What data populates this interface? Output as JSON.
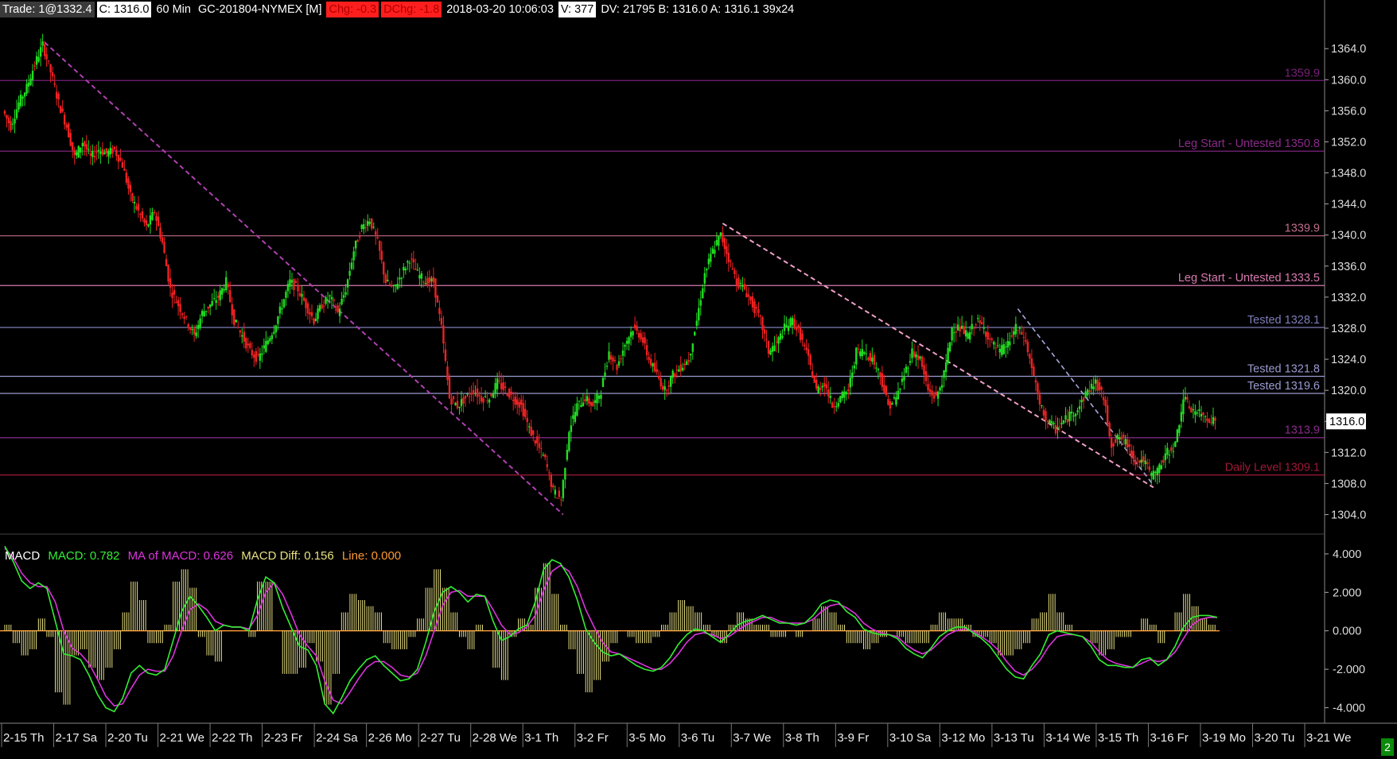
{
  "header": {
    "trade": "Trade: 1@1332.4",
    "close": "C: 1316.0",
    "interval": "60 Min",
    "symbol": "GC-201804-NYMEX [M]",
    "chg": "Chg: -0.3",
    "dchg": "DChg: -1.8",
    "datetime": "2018-03-20 10:06:03",
    "volume": "V: 377",
    "rest": "DV: 21795 B: 1316.0 A: 1316.1 39x24"
  },
  "macd_header": {
    "title": "MACD",
    "macd": "MACD: 0.782",
    "ma": "MA of MACD: 0.626",
    "diff": "MACD Diff: 0.156",
    "line": "Line: 0.000"
  },
  "scroll_indicator": "2",
  "colors": {
    "background": "#000000",
    "bull": "#22dd22",
    "bear": "#ee2222",
    "macd_line": "#33ee33",
    "ma_line": "#dd33dd",
    "diff_bars": "#e8e080",
    "zero_line": "#ff9933"
  },
  "chart_data": [
    {
      "type": "candlestick",
      "title": "",
      "y_ticks": [
        1364.0,
        1360.0,
        1356.0,
        1352.0,
        1348.0,
        1344.0,
        1340.0,
        1336.0,
        1332.0,
        1328.0,
        1324.0,
        1320.0,
        1316.0,
        1312.0,
        1308.0,
        1304.0
      ],
      "ylim": [
        1302.0,
        1367.5
      ],
      "last_price": "1316.0",
      "x_labels": [
        "2-15 Th",
        "2-17 Sa",
        "2-20 Tu",
        "2-21 We",
        "2-22 Th",
        "2-23 Fr",
        "2-24 Sa",
        "2-26 Mo",
        "2-27 Tu",
        "2-28 We",
        "3-1 Th",
        "3-2 Fr",
        "3-5 Mo",
        "3-6 Tu",
        "3-7 We",
        "3-8 Th",
        "3-9 Fr",
        "3-10 Sa",
        "3-12 Mo",
        "3-13 Tu",
        "3-14 We",
        "3-15 Th",
        "3-16 Fr",
        "3-19 Mo",
        "3-20 Tu",
        "3-21 We"
      ],
      "price_path": [
        [
          0,
          1356
        ],
        [
          1,
          1354
        ],
        [
          2,
          1357
        ],
        [
          3,
          1359
        ],
        [
          4,
          1362
        ],
        [
          5,
          1364.5
        ],
        [
          6,
          1361
        ],
        [
          7,
          1357
        ],
        [
          8,
          1354
        ],
        [
          9,
          1350
        ],
        [
          10,
          1352
        ],
        [
          11,
          1350
        ],
        [
          12,
          1351
        ],
        [
          13,
          1350.5
        ],
        [
          14,
          1351
        ],
        [
          15,
          1349
        ],
        [
          16,
          1345
        ],
        [
          17,
          1343
        ],
        [
          18,
          1341
        ],
        [
          19,
          1343
        ],
        [
          20,
          1339
        ],
        [
          21,
          1333
        ],
        [
          22,
          1331
        ],
        [
          23,
          1329
        ],
        [
          24,
          1327
        ],
        [
          25,
          1330
        ],
        [
          26,
          1331
        ],
        [
          27,
          1332
        ],
        [
          28,
          1334
        ],
        [
          29,
          1329
        ],
        [
          30,
          1327
        ],
        [
          31,
          1325
        ],
        [
          32,
          1324
        ],
        [
          33,
          1326
        ],
        [
          34,
          1328
        ],
        [
          35,
          1331
        ],
        [
          36,
          1334
        ],
        [
          37,
          1333
        ],
        [
          38,
          1331
        ],
        [
          39,
          1329
        ],
        [
          40,
          1331
        ],
        [
          41,
          1332
        ],
        [
          42,
          1330
        ],
        [
          43,
          1333
        ],
        [
          44,
          1338
        ],
        [
          45,
          1341
        ],
        [
          46,
          1342
        ],
        [
          47,
          1339
        ],
        [
          48,
          1334
        ],
        [
          49,
          1333
        ],
        [
          50,
          1335
        ],
        [
          51,
          1337
        ],
        [
          52,
          1335
        ],
        [
          53,
          1334
        ],
        [
          54,
          1334
        ],
        [
          55,
          1328
        ],
        [
          56,
          1319
        ],
        [
          57,
          1318
        ],
        [
          58,
          1319
        ],
        [
          59,
          1320
        ],
        [
          60,
          1319
        ],
        [
          61,
          1319
        ],
        [
          62,
          1321
        ],
        [
          63,
          1320
        ],
        [
          64,
          1319
        ],
        [
          65,
          1318
        ],
        [
          66,
          1315
        ],
        [
          67,
          1313
        ],
        [
          68,
          1311
        ],
        [
          69,
          1307
        ],
        [
          70,
          1306
        ],
        [
          71,
          1315
        ],
        [
          72,
          1318
        ],
        [
          73,
          1319
        ],
        [
          74,
          1318
        ],
        [
          75,
          1320
        ],
        [
          76,
          1325
        ],
        [
          77,
          1323
        ],
        [
          78,
          1326
        ],
        [
          79,
          1328
        ],
        [
          80,
          1327
        ],
        [
          81,
          1324
        ],
        [
          82,
          1322
        ],
        [
          83,
          1320
        ],
        [
          84,
          1322
        ],
        [
          85,
          1323
        ],
        [
          86,
          1324
        ],
        [
          87,
          1329
        ],
        [
          88,
          1335
        ],
        [
          89,
          1338
        ],
        [
          90,
          1340
        ],
        [
          91,
          1337
        ],
        [
          92,
          1334
        ],
        [
          93,
          1333
        ],
        [
          94,
          1331
        ],
        [
          95,
          1329
        ],
        [
          96,
          1325
        ],
        [
          97,
          1326
        ],
        [
          98,
          1328
        ],
        [
          99,
          1329
        ],
        [
          100,
          1327
        ],
        [
          101,
          1324
        ],
        [
          102,
          1320
        ],
        [
          103,
          1321
        ],
        [
          104,
          1318
        ],
        [
          105,
          1319
        ],
        [
          106,
          1320
        ],
        [
          107,
          1325
        ],
        [
          108,
          1325
        ],
        [
          109,
          1324
        ],
        [
          110,
          1322
        ],
        [
          111,
          1318
        ],
        [
          112,
          1319
        ],
        [
          113,
          1322
        ],
        [
          114,
          1325
        ],
        [
          115,
          1324
        ],
        [
          116,
          1320
        ],
        [
          117,
          1319
        ],
        [
          118,
          1322
        ],
        [
          119,
          1328
        ],
        [
          120,
          1328
        ],
        [
          121,
          1327
        ],
        [
          122,
          1329
        ],
        [
          123,
          1328
        ],
        [
          124,
          1326
        ],
        [
          125,
          1325
        ],
        [
          126,
          1326
        ],
        [
          127,
          1328
        ],
        [
          128,
          1327
        ],
        [
          129,
          1323
        ],
        [
          130,
          1318
        ],
        [
          131,
          1316
        ],
        [
          132,
          1315
        ],
        [
          133,
          1316
        ],
        [
          134,
          1317
        ],
        [
          135,
          1318
        ],
        [
          136,
          1320
        ],
        [
          137,
          1321
        ],
        [
          138,
          1319
        ],
        [
          139,
          1313
        ],
        [
          140,
          1314
        ],
        [
          141,
          1313
        ],
        [
          142,
          1311
        ],
        [
          143,
          1311
        ],
        [
          144,
          1309
        ],
        [
          145,
          1310
        ],
        [
          146,
          1312
        ],
        [
          147,
          1313
        ],
        [
          148,
          1319
        ],
        [
          149,
          1317.5
        ],
        [
          150,
          1317
        ],
        [
          151,
          1316.5
        ],
        [
          152,
          1316
        ]
      ],
      "annotations": [
        {
          "text": "1359.9",
          "price": 1359.9,
          "color": "#7a1f7a"
        },
        {
          "text": "Leg Start - Untested  1350.8",
          "price": 1350.8,
          "color": "#8a2a8a"
        },
        {
          "text": "1339.9",
          "price": 1339.9,
          "color": "#c06c8a"
        },
        {
          "text": "Leg Start - Untested  1333.5",
          "price": 1333.5,
          "color": "#d87ab0"
        },
        {
          "text": "Tested  1328.1",
          "price": 1328.1,
          "color": "#7c7cb8"
        },
        {
          "text": "Tested  1321.8",
          "price": 1321.8,
          "color": "#9a9ad0"
        },
        {
          "text": "Tested  1319.6",
          "price": 1319.6,
          "color": "#9a9ad0"
        },
        {
          "text": "1313.9",
          "price": 1313.9,
          "color": "#8a2a8a"
        },
        {
          "text": "Daily Level  1309.1",
          "price": 1309.1,
          "color": "#a01838"
        }
      ]
    },
    {
      "type": "line",
      "title": "MACD",
      "y_ticks": [
        4.0,
        2.0,
        0.0,
        -2.0,
        -4.0
      ],
      "y_tick_labels": [
        "4.000",
        "2.000",
        "0.000",
        "-2.000",
        "-4.000"
      ],
      "ylim": [
        -4.6,
        4.7
      ],
      "series": [
        {
          "name": "MACD",
          "values": [
            4.4,
            3.6,
            2.6,
            2.2,
            2.5,
            2.2,
            0.5,
            -1.2,
            -1.3,
            -1.5,
            -2.3,
            -3.3,
            -4.0,
            -4.2,
            -3.5,
            -2.2,
            -1.8,
            -2.2,
            -2.3,
            -2.0,
            -0.5,
            1.0,
            1.8,
            1.3,
            0.7,
            0.0,
            0.3,
            0.2,
            0.2,
            0.0,
            1.6,
            2.8,
            2.5,
            1.2,
            0.2,
            -0.8,
            -1.0,
            -1.8,
            -3.8,
            -4.3,
            -3.5,
            -2.6,
            -2.0,
            -1.5,
            -1.3,
            -1.8,
            -2.2,
            -2.6,
            -2.5,
            -2.0,
            -0.6,
            1.0,
            2.0,
            2.3,
            2.0,
            1.5,
            1.9,
            1.8,
            0.5,
            -0.5,
            -0.3,
            0.1,
            0.3,
            1.5,
            3.2,
            3.7,
            3.5,
            2.8,
            1.6,
            0.1,
            -0.6,
            -1.1,
            -1.3,
            -1.2,
            -1.5,
            -1.8,
            -2.0,
            -2.1,
            -1.9,
            -1.4,
            -0.7,
            -0.2,
            0.1,
            0.0,
            -0.3,
            -0.6,
            -0.2,
            0.3,
            0.5,
            0.6,
            0.8,
            0.6,
            0.4,
            0.4,
            0.3,
            0.4,
            0.8,
            1.4,
            1.6,
            1.5,
            1.0,
            0.7,
            0.1,
            -0.1,
            -0.2,
            -0.2,
            -0.4,
            -0.9,
            -1.2,
            -1.4,
            -0.9,
            -0.3,
            0.0,
            0.2,
            0.2,
            -0.1,
            -0.4,
            -0.8,
            -1.4,
            -2.0,
            -2.4,
            -2.5,
            -1.8,
            -1.2,
            -0.2,
            0.0,
            -0.1,
            -0.2,
            -0.3,
            -0.8,
            -1.5,
            -1.8,
            -1.8,
            -1.9,
            -1.9,
            -1.5,
            -1.4,
            -1.8,
            -1.5,
            -0.8,
            0.2,
            0.7,
            0.8,
            0.8,
            0.7
          ]
        },
        {
          "name": "MA of MACD",
          "values": [
            4.3,
            3.8,
            3.0,
            2.5,
            2.3,
            2.3,
            1.5,
            0.0,
            -0.9,
            -1.2,
            -1.7,
            -2.5,
            -3.4,
            -3.9,
            -3.8,
            -3.0,
            -2.3,
            -2.0,
            -2.1,
            -2.1,
            -1.3,
            0.0,
            1.1,
            1.4,
            1.1,
            0.5,
            0.3,
            0.2,
            0.2,
            0.1,
            0.8,
            2.0,
            2.5,
            1.9,
            0.9,
            -0.2,
            -0.8,
            -1.3,
            -2.6,
            -3.6,
            -3.8,
            -3.2,
            -2.5,
            -1.9,
            -1.6,
            -1.6,
            -1.9,
            -2.3,
            -2.4,
            -2.2,
            -1.3,
            0.0,
            1.3,
            2.0,
            2.1,
            1.8,
            1.8,
            1.8,
            1.1,
            0.3,
            -0.2,
            -0.1,
            0.2,
            0.8,
            2.1,
            3.1,
            3.4,
            3.1,
            2.3,
            1.1,
            0.2,
            -0.6,
            -1.1,
            -1.2,
            -1.4,
            -1.6,
            -1.8,
            -2.0,
            -2.0,
            -1.7,
            -1.2,
            -0.6,
            -0.2,
            -0.1,
            -0.2,
            -0.4,
            -0.3,
            0.0,
            0.3,
            0.5,
            0.7,
            0.7,
            0.5,
            0.4,
            0.4,
            0.4,
            0.6,
            1.0,
            1.3,
            1.4,
            1.2,
            0.9,
            0.4,
            0.1,
            -0.1,
            -0.2,
            -0.3,
            -0.7,
            -1.0,
            -1.2,
            -1.0,
            -0.6,
            -0.2,
            0.0,
            0.1,
            0.0,
            -0.3,
            -0.6,
            -1.0,
            -1.6,
            -2.1,
            -2.3,
            -2.0,
            -1.5,
            -0.8,
            -0.3,
            -0.2,
            -0.2,
            -0.3,
            -0.6,
            -1.1,
            -1.5,
            -1.7,
            -1.8,
            -1.9,
            -1.7,
            -1.5,
            -1.6,
            -1.5,
            -1.1,
            -0.4,
            0.3,
            0.6,
            0.7,
            0.7
          ]
        }
      ]
    }
  ]
}
